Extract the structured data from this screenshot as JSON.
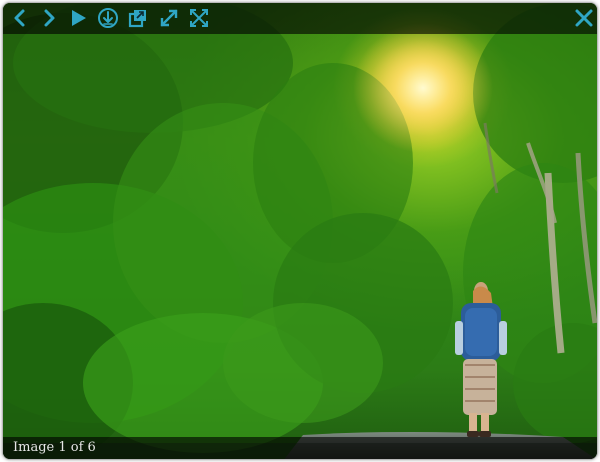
{
  "lightbox": {
    "caption": "Image 1 of 6",
    "toolbar": {
      "previous": {
        "icon": "chevron-left-icon"
      },
      "next": {
        "icon": "chevron-right-icon"
      },
      "slideshow": {
        "icon": "play-icon"
      },
      "download": {
        "icon": "download-icon"
      },
      "open_new_window": {
        "icon": "external-link-icon"
      },
      "fullscreen": {
        "icon": "expand-diagonal-icon"
      },
      "fit_to_screen": {
        "icon": "arrows-out-icon"
      },
      "close": {
        "icon": "close-icon"
      }
    },
    "colors": {
      "icon": "#2fa6c4",
      "bar_background": "#000000"
    }
  }
}
